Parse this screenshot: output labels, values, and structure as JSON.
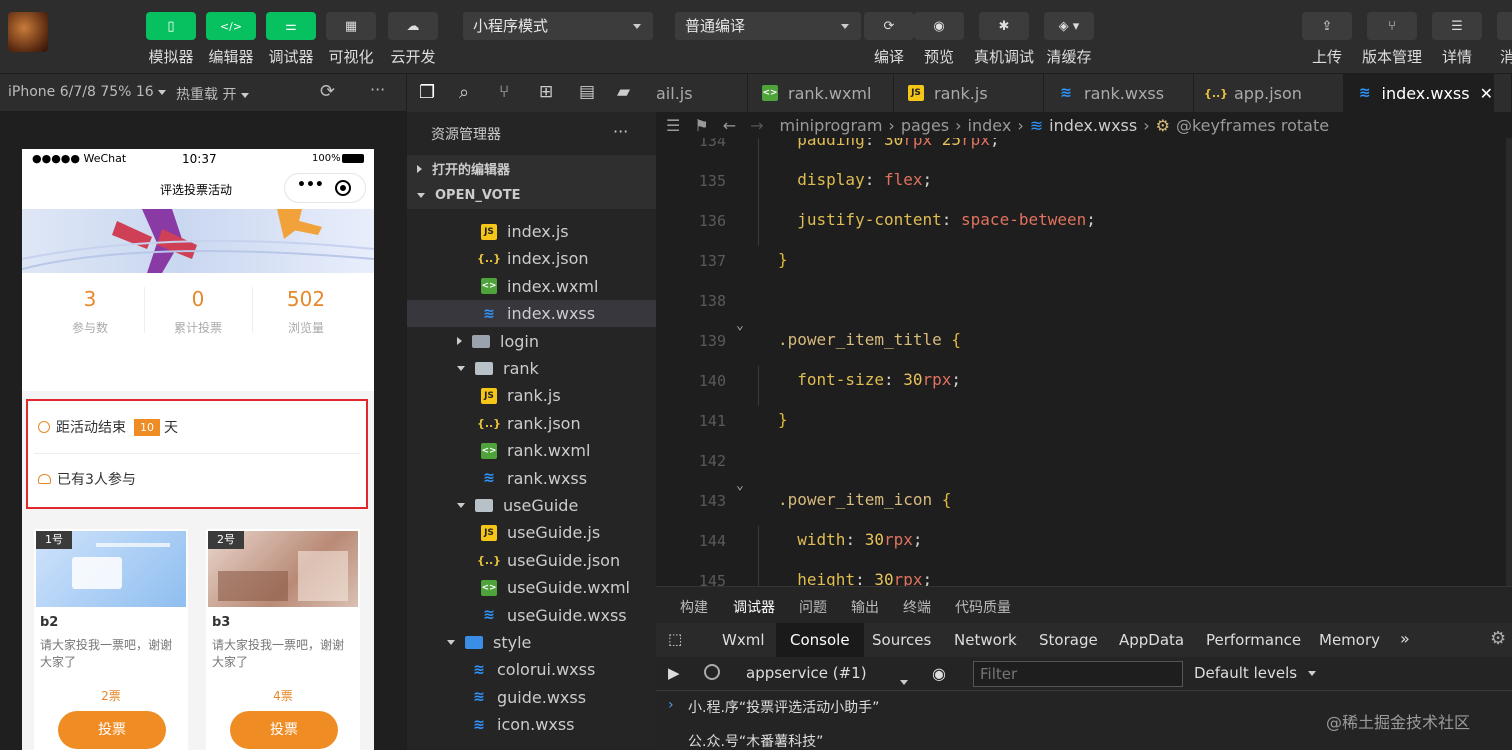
{
  "toolbar": {
    "left_buttons": [
      {
        "label": "模拟器",
        "icon": "phone-icon"
      },
      {
        "label": "编辑器",
        "icon": "code-icon"
      },
      {
        "label": "调试器",
        "icon": "sliders-icon"
      },
      {
        "label": "可视化",
        "icon": "layout-icon"
      },
      {
        "label": "云开发",
        "icon": "cloud-icon"
      }
    ],
    "mode_select": "小程序模式",
    "compile_select": "普通编译",
    "right_buttons": [
      {
        "label": "编译",
        "icon": "refresh-icon"
      },
      {
        "label": "预览",
        "icon": "eye-icon"
      },
      {
        "label": "真机调试",
        "icon": "bug-icon"
      },
      {
        "label": "清缓存",
        "icon": "layers-icon"
      }
    ],
    "far_right_buttons": [
      {
        "label": "上传",
        "icon": "upload-icon"
      },
      {
        "label": "版本管理",
        "icon": "branch-icon"
      },
      {
        "label": "详情",
        "icon": "menu-icon"
      },
      {
        "label": "消",
        "icon": "more-icon"
      }
    ]
  },
  "simulator": {
    "device": "iPhone 6/7/8 75% 16",
    "hot_reload": "热重载 开",
    "status": {
      "carrier": "●●●●● WeChat",
      "time": "10:37",
      "battery": "100%"
    },
    "nav_title": "评选投票活动",
    "stats": [
      {
        "value": "3",
        "label": "参与数"
      },
      {
        "value": "0",
        "label": "累计投票"
      },
      {
        "value": "502",
        "label": "浏览量"
      }
    ],
    "countdown_prefix": "距活动结束",
    "countdown_days": "10",
    "countdown_suffix": "天",
    "participants": "已有3人参与",
    "cards": [
      {
        "no": "1号",
        "title": "b2",
        "desc": "请大家投我一票吧，谢谢大家了",
        "count": "2票",
        "button": "投票"
      },
      {
        "no": "2号",
        "title": "b3",
        "desc": "请大家投我一票吧，谢谢大家了",
        "count": "4票",
        "button": "投票"
      }
    ]
  },
  "explorer": {
    "title": "资源管理器",
    "more": "···",
    "sections": {
      "open_editors": "打开的编辑器",
      "project": "OPEN_VOTE"
    },
    "tree": [
      {
        "name": "index.js",
        "type": "js",
        "indent": 2
      },
      {
        "name": "index.json",
        "type": "json",
        "indent": 2
      },
      {
        "name": "index.wxml",
        "type": "wxml",
        "indent": 2
      },
      {
        "name": "index.wxss",
        "type": "wxss",
        "indent": 2,
        "selected": true
      },
      {
        "name": "login",
        "type": "folder",
        "indent": 1,
        "expanded": false
      },
      {
        "name": "rank",
        "type": "folder-open",
        "indent": 1,
        "expanded": true
      },
      {
        "name": "rank.js",
        "type": "js",
        "indent": 2
      },
      {
        "name": "rank.json",
        "type": "json",
        "indent": 2
      },
      {
        "name": "rank.wxml",
        "type": "wxml",
        "indent": 2
      },
      {
        "name": "rank.wxss",
        "type": "wxss",
        "indent": 2
      },
      {
        "name": "useGuide",
        "type": "folder-open",
        "indent": 1,
        "expanded": true
      },
      {
        "name": "useGuide.js",
        "type": "js",
        "indent": 2
      },
      {
        "name": "useGuide.json",
        "type": "json",
        "indent": 2
      },
      {
        "name": "useGuide.wxml",
        "type": "wxml",
        "indent": 2
      },
      {
        "name": "useGuide.wxss",
        "type": "wxss",
        "indent": 2
      },
      {
        "name": "style",
        "type": "folder-style",
        "indent": 0,
        "expanded": true
      },
      {
        "name": "colorui.wxss",
        "type": "wxss",
        "indent": 1
      },
      {
        "name": "guide.wxss",
        "type": "wxss",
        "indent": 1
      },
      {
        "name": "icon.wxss",
        "type": "wxss",
        "indent": 1
      }
    ]
  },
  "editor": {
    "tabs": [
      {
        "label": "ail.js",
        "icon": ""
      },
      {
        "label": "rank.wxml",
        "icon": "wxml"
      },
      {
        "label": "rank.js",
        "icon": "js"
      },
      {
        "label": "rank.wxss",
        "icon": "wxss"
      },
      {
        "label": "app.json",
        "icon": "json"
      },
      {
        "label": "index.wxss",
        "icon": "wxss",
        "active": true
      }
    ],
    "breadcrumb": [
      "miniprogram",
      "pages",
      "index",
      "index.wxss",
      "@keyframes rotate"
    ],
    "lines": [
      {
        "n": "134",
        "text": "  padding: 30rpx 25rpx;"
      },
      {
        "n": "135",
        "text": "  display: flex;"
      },
      {
        "n": "136",
        "text": "  justify-content: space-between;"
      },
      {
        "n": "137",
        "text": "}"
      },
      {
        "n": "138",
        "text": ""
      },
      {
        "n": "139",
        "text": ".power_item_title {"
      },
      {
        "n": "140",
        "text": "  font-size: 30rpx;"
      },
      {
        "n": "141",
        "text": "}"
      },
      {
        "n": "142",
        "text": ""
      },
      {
        "n": "143",
        "text": ".power_item_icon {"
      },
      {
        "n": "144",
        "text": "  width: 30rpx;"
      },
      {
        "n": "145",
        "text": "  height: 30rpx;"
      }
    ]
  },
  "panel": {
    "tabs": [
      "构建",
      "调试器",
      "问题",
      "输出",
      "终端",
      "代码质量"
    ],
    "active_tab": "调试器",
    "devtools_tabs": [
      "Wxml",
      "Console",
      "Sources",
      "Network",
      "Storage",
      "AppData",
      "Performance",
      "Memory"
    ],
    "active_devtools_tab": "Console",
    "more": "»",
    "context": "appservice (#1)",
    "filter_placeholder": "Filter",
    "levels": "Default levels",
    "console_lines": [
      "小.程.序“投票评选活动小助手”",
      "公.众.号“木番薯科技”"
    ],
    "watermark": "@稀土掘金技术社区"
  },
  "colors": {
    "accent_green": "#07c160",
    "orange": "#f08c24",
    "highlight_red": "#e0282d",
    "wxss_blue": "#2f95ff"
  }
}
